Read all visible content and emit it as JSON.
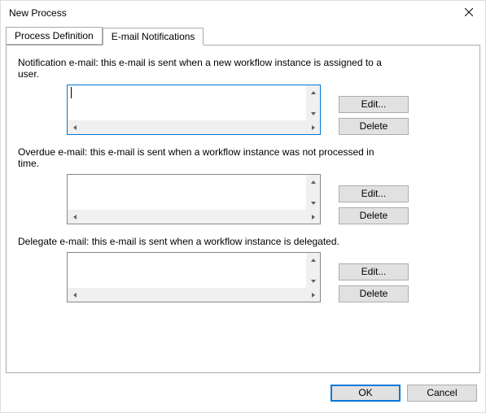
{
  "window": {
    "title": "New Process"
  },
  "tabs": {
    "process_definition": "Process Definition",
    "email_notifications": "E-mail Notifications"
  },
  "sections": {
    "notification": {
      "desc": "Notification e-mail: this e-mail is sent when a new workflow instance is assigned to a user.",
      "value": "",
      "edit": "Edit...",
      "delete": "Delete"
    },
    "overdue": {
      "desc": "Overdue e-mail: this e-mail is sent when a workflow instance was not processed in time.",
      "value": "",
      "edit": "Edit...",
      "delete": "Delete"
    },
    "delegate": {
      "desc": "Delegate e-mail: this e-mail is sent when a workflow instance is delegated.",
      "value": "",
      "edit": "Edit...",
      "delete": "Delete"
    }
  },
  "footer": {
    "ok": "OK",
    "cancel": "Cancel"
  }
}
